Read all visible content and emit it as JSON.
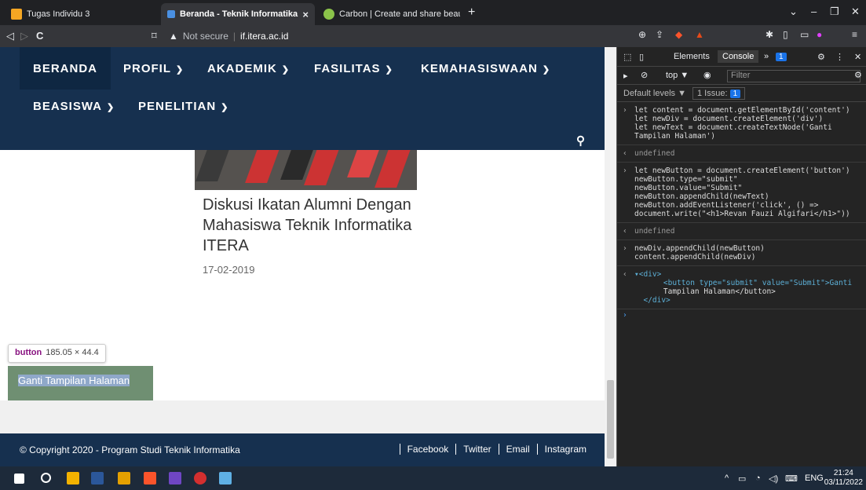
{
  "browser": {
    "tabs": [
      {
        "title": "Tugas Individu 3",
        "favicon_color": "#f5a623"
      },
      {
        "title": "Beranda - Teknik Informatika",
        "favicon_color": "#4a90e2",
        "close": "×"
      },
      {
        "title": "Carbon | Create and share beautiful im",
        "favicon_color": "#8bc34a"
      }
    ],
    "new_tab": "+",
    "address": {
      "security_label": "Not secure",
      "host": "if.itera.ac.id"
    },
    "window_controls": [
      "⌄",
      "–",
      "❐",
      "✕"
    ]
  },
  "site": {
    "menu": [
      {
        "label": "BERANDA",
        "has_dropdown": false
      },
      {
        "label": "PROFIL",
        "has_dropdown": true
      },
      {
        "label": "AKADEMIK",
        "has_dropdown": true
      },
      {
        "label": "FASILITAS",
        "has_dropdown": true
      },
      {
        "label": "KEMAHASISWAAN",
        "has_dropdown": true
      },
      {
        "label": "BEASISWA",
        "has_dropdown": true
      },
      {
        "label": "PENELITIAN",
        "has_dropdown": true
      }
    ],
    "article": {
      "title": "Diskusi Ikatan Alumni Dengan Mahasiswa Teknik Informatika ITERA",
      "date": "17-02-2019"
    },
    "tooltip": {
      "tag": "button",
      "size": "185.05 × 44.4"
    },
    "button_label": "Ganti Tampilan Halaman",
    "footer": {
      "copyright": "© Copyright 2020 - Program Studi Teknik Informatika",
      "links": [
        "Facebook",
        "Twitter",
        "Email",
        "Instagram"
      ]
    }
  },
  "devtools": {
    "tabs": [
      "Elements",
      "Console"
    ],
    "active_tab": "Console",
    "issues_badge": "1",
    "context": "top ▼",
    "filter_placeholder": "Filter",
    "levels": "Default levels ▼",
    "issues_label": "1 Issue:",
    "issue_count": "1",
    "console": [
      "let content = document.getElementById('content')\nlet newDiv = document.createElement('div')\nlet newText = document.createTextNode('Ganti\nTampilan Halaman')",
      "undefined",
      "let newButton = document.createElement('button')\nnewButton.type=\"submit\"\nnewButton.value=\"Submit\"\nnewButton.appendChild(newText)\nnewButton.addEventListener('click', () =>\ndocument.write(\"<h1>Revan Fauzi Algifari</h1>\"))",
      "undefined",
      "newDiv.appendChild(newButton)\ncontent.appendChild(newDiv)"
    ],
    "result_open": "▾<div>",
    "result_button": "<button type=\"submit\" value=\"Submit\">Ganti",
    "result_button_2": "Tampilan Halaman</button>",
    "result_close": "</div>"
  },
  "taskbar": {
    "lang": "ENG",
    "time": "21:24",
    "date": "03/11/2022"
  }
}
